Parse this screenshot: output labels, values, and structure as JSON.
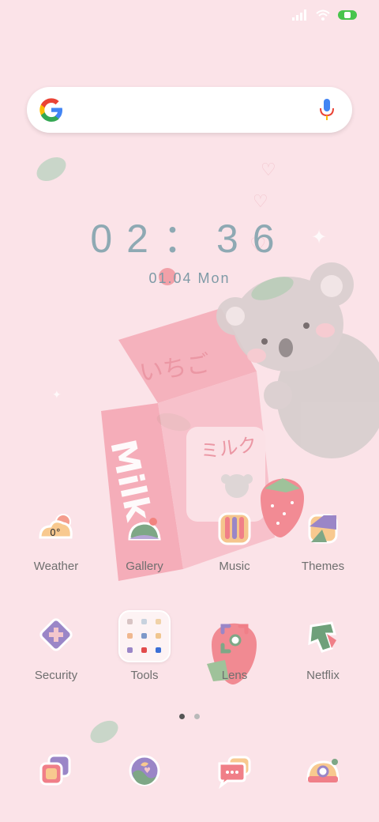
{
  "status": {
    "icons": [
      "signal-icon",
      "wifi-icon",
      "battery-icon"
    ]
  },
  "search": {
    "icons": [
      "google-logo-icon",
      "mic-icon"
    ]
  },
  "clock": {
    "time": "02：36",
    "date": "01.04 Mon"
  },
  "apps_row1": [
    {
      "label": "Weather",
      "icon": "weather-icon",
      "badge": "0°"
    },
    {
      "label": "Gallery",
      "icon": "gallery-icon"
    },
    {
      "label": "Music",
      "icon": "music-icon"
    },
    {
      "label": "Themes",
      "icon": "themes-icon"
    }
  ],
  "apps_row2": [
    {
      "label": "Security",
      "icon": "security-icon"
    },
    {
      "label": "Tools",
      "icon": "tools-folder-icon"
    },
    {
      "label": "Lens",
      "icon": "lens-icon"
    },
    {
      "label": "Netflix",
      "icon": "netflix-icon"
    }
  ],
  "dock": [
    {
      "icon": "photos-icon"
    },
    {
      "icon": "browser-icon"
    },
    {
      "icon": "messages-icon"
    },
    {
      "icon": "camera-icon"
    }
  ],
  "wallpaper": {
    "box_text_1": "いちご",
    "box_text_2": "ミルク",
    "box_text_3": "Milk"
  },
  "colors": {
    "background": "#fbe3e8",
    "clock": "#8ea9b3",
    "label": "#6f6f6f"
  }
}
